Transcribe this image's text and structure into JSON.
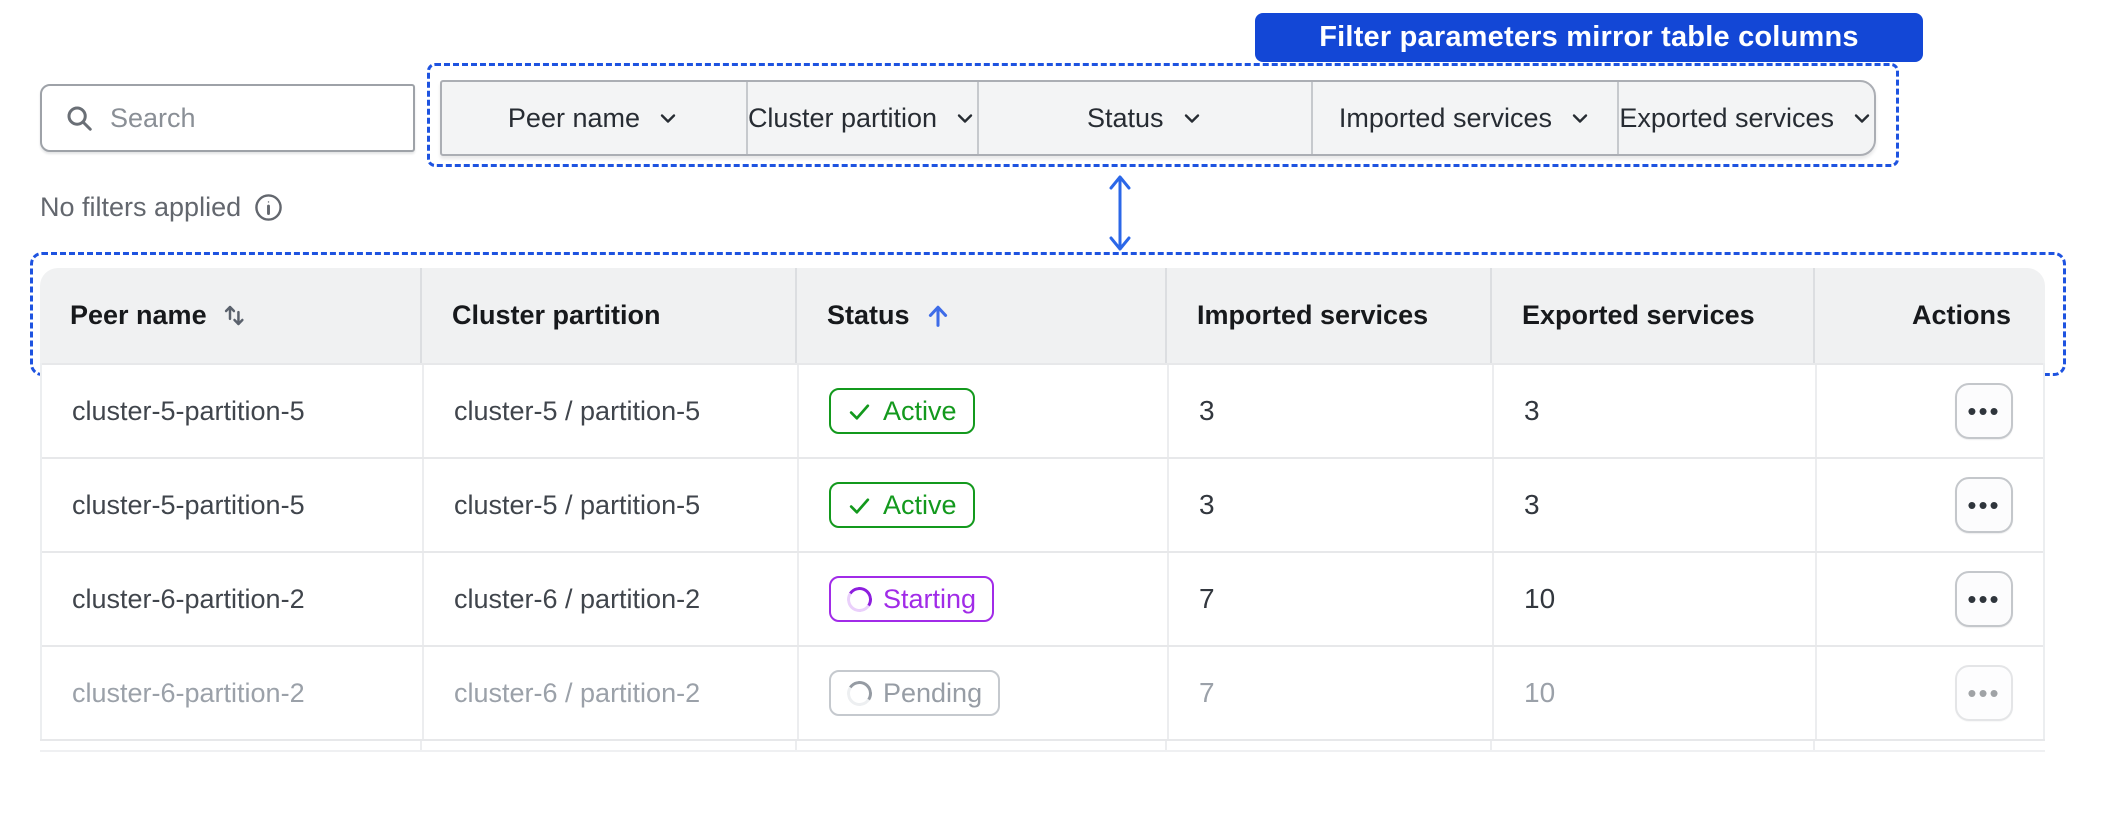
{
  "callout": {
    "label": "Filter parameters mirror table columns"
  },
  "toolbar": {
    "search": {
      "placeholder": "Search"
    },
    "filters": {
      "items": [
        {
          "label": "Peer name"
        },
        {
          "label": "Cluster partition"
        },
        {
          "label": "Status"
        },
        {
          "label": "Imported services"
        },
        {
          "label": "Exported services"
        }
      ]
    }
  },
  "filter_summary": {
    "text": "No filters applied"
  },
  "table": {
    "columns": [
      {
        "label": "Peer name",
        "sort": "sortable"
      },
      {
        "label": "Cluster partition",
        "sort": "none"
      },
      {
        "label": "Status",
        "sort": "ascending"
      },
      {
        "label": "Imported services",
        "sort": "none"
      },
      {
        "label": "Exported services",
        "sort": "none"
      },
      {
        "label": "Actions",
        "sort": "none"
      }
    ],
    "action_menu_icon": "•••",
    "rows": [
      {
        "peer": "cluster-5-partition-5",
        "partition": "cluster-5 / partition-5",
        "status": "Active",
        "badge_class": "active",
        "imported": "3",
        "exported": "3",
        "row_class": ""
      },
      {
        "peer": "cluster-5-partition-5",
        "partition": "cluster-5 / partition-5",
        "status": "Active",
        "badge_class": "active",
        "imported": "3",
        "exported": "3",
        "row_class": ""
      },
      {
        "peer": "cluster-6-partition-2",
        "partition": "cluster-6 / partition-2",
        "status": "Starting",
        "badge_class": "starting",
        "imported": "7",
        "exported": "10",
        "row_class": ""
      },
      {
        "peer": "cluster-6-partition-2",
        "partition": "cluster-6 / partition-2",
        "status": "Pending",
        "badge_class": "pending",
        "imported": "7",
        "exported": "10",
        "row_class": "muted"
      }
    ]
  },
  "colors": {
    "annotation_blue": "#1E53E0",
    "callout_blue": "#1347D6",
    "arrow_blue": "#2B67E8",
    "sort_arrow_blue": "#3E6CE8",
    "active_green": "#13991D",
    "starting_purple": "#A12BE8",
    "pending_gray": "#6E747C",
    "header_bg": "#F0F1F2"
  }
}
